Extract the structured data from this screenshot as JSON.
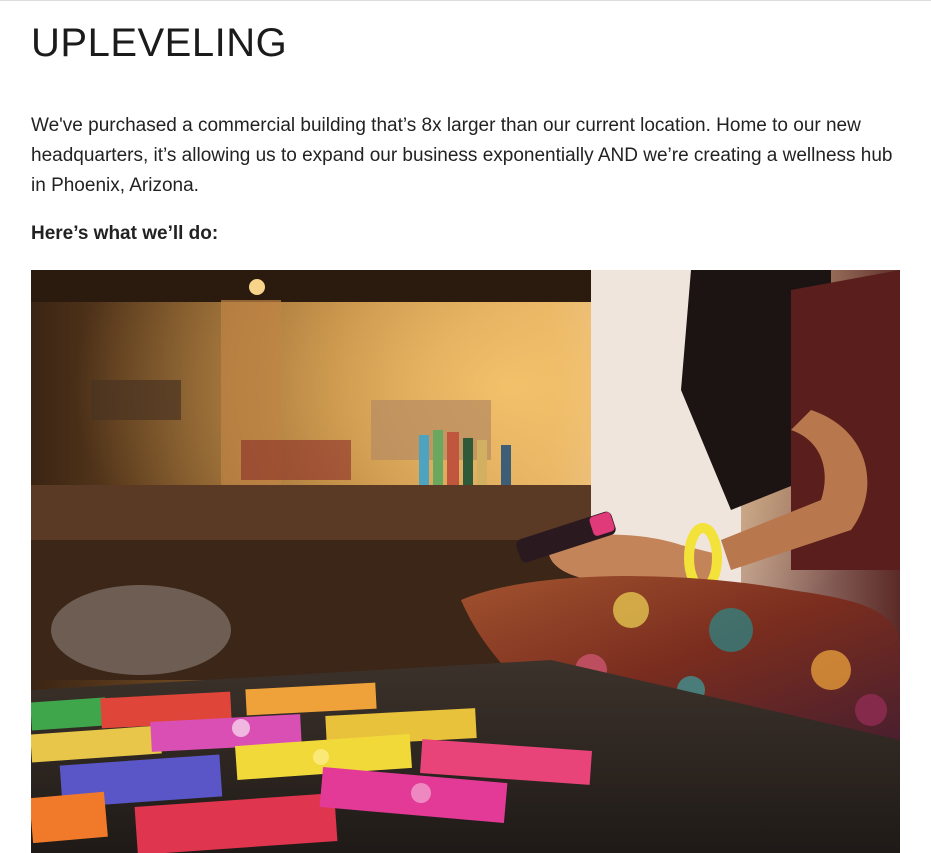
{
  "article": {
    "heading": "UPLEVELING",
    "intro": "We've purchased a commercial building that’s 8x larger than our current location. Home to our new headquarters, it’s allowing us to expand our business exponentially AND we’re creating a wellness hub in Phoenix, Arizona.",
    "lead": "Here’s what we’ll do:"
  },
  "image": {
    "alt": "",
    "colors": {
      "warm_light": "#e8a445",
      "wall": "#d9b58a",
      "counter": "#5a3a24",
      "table": "#2c2520",
      "skin": "#b9774d",
      "bracelet": "#f2e23a",
      "fabric": "#8d3a22"
    }
  }
}
